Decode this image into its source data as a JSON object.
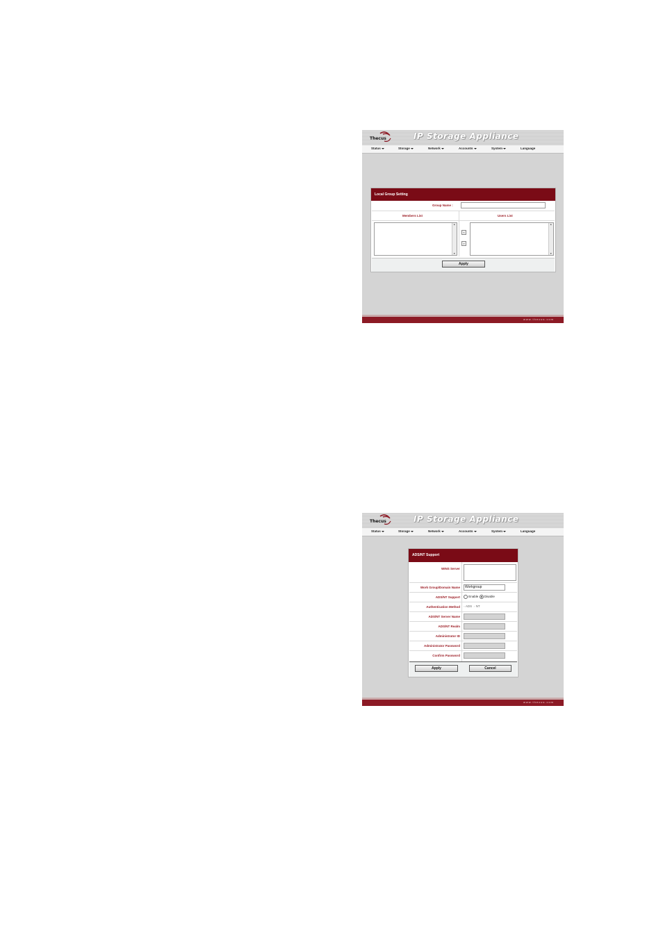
{
  "screens": [
    {
      "app_title": "IP Storage Appliance",
      "logo_text": "Thecus",
      "menu": [
        "Status",
        "Storage",
        "Network",
        "Accounts",
        "System",
        "Language"
      ],
      "footer_url": "www.thecus.com",
      "panel": {
        "title": "Local Group Setting",
        "group_name_label": "Group Name :",
        "group_name_value": "",
        "members_list_label": "Members List",
        "users_list_label": "Users List",
        "move_left": "«",
        "move_right": "»",
        "apply_label": "Apply"
      }
    },
    {
      "app_title": "IP Storage Appliance",
      "logo_text": "Thecus",
      "menu": [
        "Status",
        "Storage",
        "Network",
        "Accounts",
        "System",
        "Language"
      ],
      "footer_url": "www.thecus.com",
      "panel": {
        "title": "ADS/NT Support",
        "rows": [
          {
            "label": "WINS Server",
            "value": ""
          },
          {
            "label": "Work Group/Domain Name",
            "value": "Workgroup"
          },
          {
            "label": "ADS/NT Support",
            "options": [
              "Enable",
              "Disable"
            ],
            "selected": "Disable"
          },
          {
            "label": "Authentication Method",
            "options": [
              "ADS",
              "NT"
            ]
          },
          {
            "label": "ADS/NT Server Name",
            "value": ""
          },
          {
            "label": "ADS/NT Realm",
            "value": ""
          },
          {
            "label": "Administrator ID",
            "value": ""
          },
          {
            "label": "Administrator Password",
            "value": ""
          },
          {
            "label": "Confirm Password",
            "value": ""
          }
        ],
        "apply_label": "Apply",
        "cancel_label": "Cancel"
      }
    }
  ]
}
